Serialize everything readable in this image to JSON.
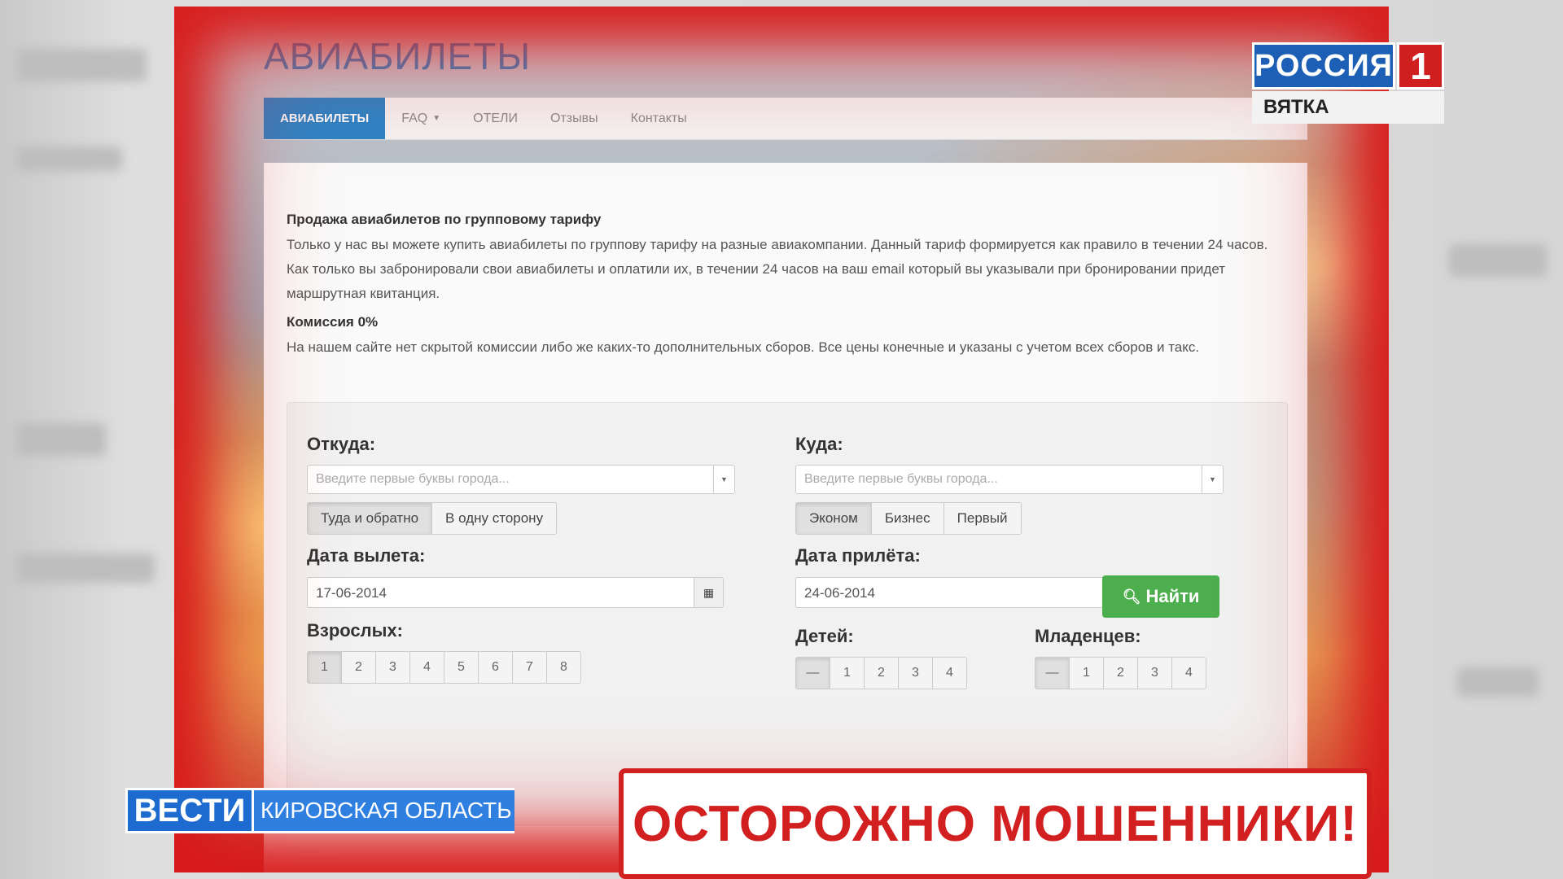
{
  "site": {
    "title": "АВИАБИЛЕТЫ",
    "nav": [
      {
        "label": "АВИАБИЛЕТЫ"
      },
      {
        "label": "FAQ"
      },
      {
        "label": "ОТЕЛИ"
      },
      {
        "label": "Отзывы"
      },
      {
        "label": "Контакты"
      }
    ]
  },
  "content": {
    "section1_title": "Продажа авиабилетов по групповому тарифу",
    "section1_text": "Только у нас вы можете купить авиабилеты по группову тарифу на разные авиакомпании. Данный тариф формируется как правило в течении 24 часов. Как только вы забронировали свои авиабилеты и оплатили их, в течении 24 часов на ваш email который вы указывали при бронировании придет маршрутная квитанция.",
    "section2_title": "Комиссия 0%",
    "section2_text": "На нашем сайте нет скрытой комиссии либо же каких-то дополнительных сборов. Все цены конечные и указаны с учетом всех сборов и такс."
  },
  "search": {
    "from_label": "Откуда:",
    "to_label": "Куда:",
    "from_placeholder": "Введите первые буквы города...",
    "to_placeholder": "Введите первые буквы города...",
    "trip_types": [
      "Туда и обратно",
      "В одну сторону"
    ],
    "classes": [
      "Эконом",
      "Бизнес",
      "Первый"
    ],
    "depart_label": "Дата вылета:",
    "arrive_label": "Дата прилёта:",
    "depart_date": "17-06-2014",
    "arrive_date": "24-06-2014",
    "adults_label": "Взрослых:",
    "children_label": "Детей:",
    "infants_label": "Младенцев:",
    "adults": [
      "1",
      "2",
      "3",
      "4",
      "5",
      "6",
      "7",
      "8"
    ],
    "children": [
      "—",
      "1",
      "2",
      "3",
      "4"
    ],
    "infants": [
      "—",
      "1",
      "2",
      "3",
      "4"
    ],
    "find_label": "Найти"
  },
  "broadcast": {
    "channel": "РОССИЯ",
    "channel_number": "1",
    "channel_region": "ВЯТКА",
    "program": "ВЕСТИ",
    "program_region": "КИРОВСКАЯ ОБЛАСТЬ",
    "warning": "ОСТОРОЖНО МОШЕННИКИ!"
  },
  "colors": {
    "frame_red": "#d21f1f",
    "nav_active": "#2a85c8",
    "find_green": "#4cae4c",
    "vesti_blue": "#1e6bd0"
  }
}
